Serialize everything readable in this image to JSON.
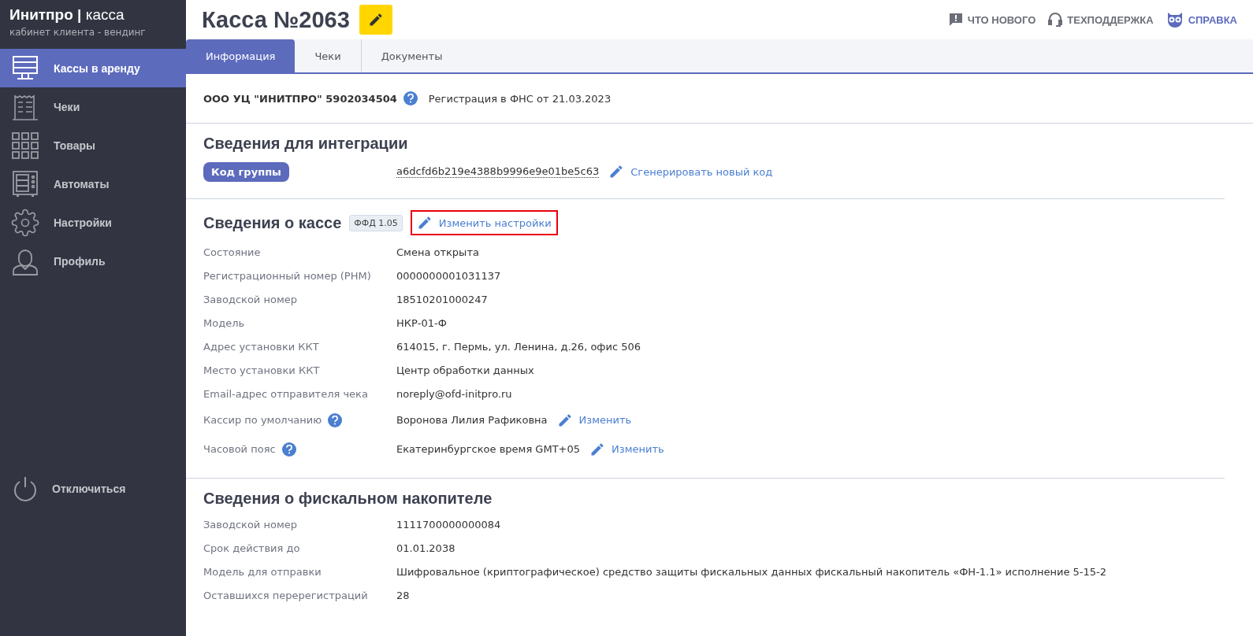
{
  "sidebar": {
    "brand": {
      "name": "Инитпро",
      "divider": "|",
      "product": "касса",
      "subtitle": "кабинет клиента - вендинг"
    },
    "items": [
      {
        "kind": "register",
        "label": "Кассы в аренду",
        "selected": true
      },
      {
        "kind": "receipt",
        "label": "Чеки",
        "selected": false
      },
      {
        "kind": "grid",
        "label": "Товары",
        "selected": false
      },
      {
        "kind": "machine",
        "label": "Автоматы",
        "selected": false
      },
      {
        "kind": "gear",
        "label": "Настройки",
        "selected": false
      },
      {
        "kind": "person",
        "label": "Профиль",
        "selected": false
      }
    ],
    "logout": "Отключиться"
  },
  "header": {
    "title": "Касса №2063",
    "links": [
      {
        "kind": "news",
        "label": "ЧТО НОВОГО"
      },
      {
        "kind": "support",
        "label": "ТЕХПОДДЕРЖКА"
      },
      {
        "kind": "help",
        "label": "СПРАВКА"
      }
    ]
  },
  "tabs": [
    {
      "label": "Информация",
      "selected": true
    },
    {
      "label": "Чеки",
      "selected": false
    },
    {
      "label": "Документы",
      "selected": false
    }
  ],
  "org": {
    "name": "ООО УЦ \"ИНИТПРО\" 5902034504",
    "registration": "Регистрация в ФНС от 21.03.2023"
  },
  "integration": {
    "title": "Сведения для интеграции",
    "badge": "Код группы",
    "code": "a6dcfd6b219e4388b9996e9e01be5c63",
    "action": "Сгенерировать новый код"
  },
  "register": {
    "title": "Сведения о кассе",
    "version": "ФФД 1.05",
    "action": {
      "label": "Изменить настройки",
      "highlighted": true
    },
    "rows": [
      {
        "label": "Состояние",
        "value": "Смена открыта"
      },
      {
        "label": "Регистрационный номер (РНМ)",
        "value": "0000000001031137"
      },
      {
        "label": "Заводской номер",
        "value": "18510201000247"
      },
      {
        "label": "Модель",
        "value": "НКР-01-Ф"
      },
      {
        "label": "Адрес установки ККТ",
        "value": "614015, г. Пермь, ул. Ленина, д.26, офис 506"
      },
      {
        "label": "Место установки ККТ",
        "value": "Центр обработки данных"
      },
      {
        "label": "Email-адрес отправителя чека",
        "value": "noreply@ofd-initpro.ru"
      },
      {
        "label": "Кассир по умолчанию",
        "help": true,
        "value": "Воронова Лилия Рафиковна",
        "action": "Изменить"
      },
      {
        "label": "Часовой пояс",
        "help": true,
        "value": "Екатеринбургское время GMT+05",
        "action": "Изменить"
      }
    ]
  },
  "fiscal": {
    "title": "Сведения о фискальном накопителе",
    "rows": [
      {
        "label": "Заводской номер",
        "value": "1111700000000084"
      },
      {
        "label": "Срок действия до",
        "value": "01.01.2038"
      },
      {
        "label": "Модель для отправки",
        "value": "Шифровальное (криптографическое) средство защиты фискальных данных фискальный накопитель «ФН-1.1» исполнение 5-15-2"
      },
      {
        "label": "Оставшихся перерегистраций",
        "value": "28"
      }
    ]
  }
}
